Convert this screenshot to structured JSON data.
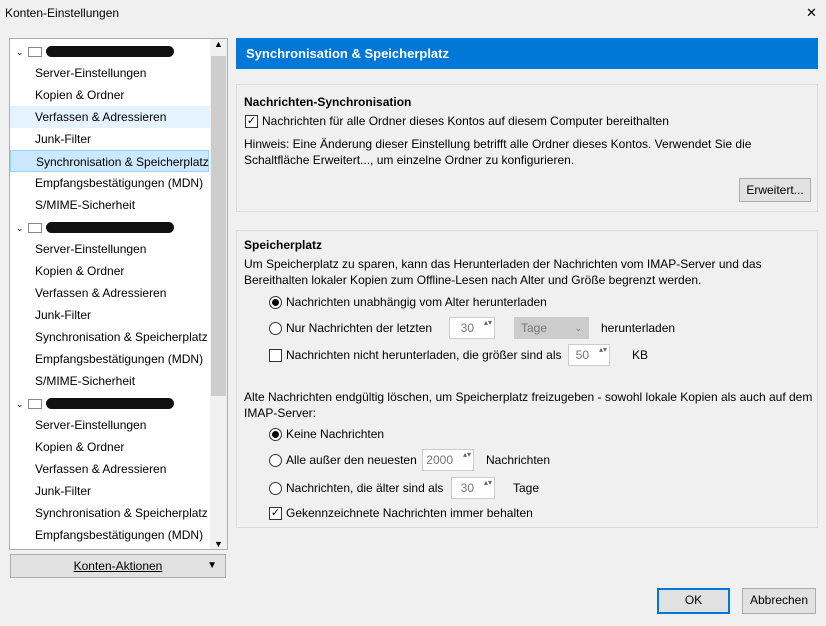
{
  "window": {
    "title": "Konten-Einstellungen",
    "close": "✕"
  },
  "tree": {
    "accounts": [
      {
        "items": [
          "Server-Einstellungen",
          "Kopien & Ordner",
          "Verfassen & Adressieren",
          "Junk-Filter",
          "Synchronisation & Speicherplatz",
          "Empfangsbestätigungen (MDN)",
          "S/MIME-Sicherheit"
        ]
      },
      {
        "items": [
          "Server-Einstellungen",
          "Kopien & Ordner",
          "Verfassen & Adressieren",
          "Junk-Filter",
          "Synchronisation & Speicherplatz",
          "Empfangsbestätigungen (MDN)",
          "S/MIME-Sicherheit"
        ]
      },
      {
        "items": [
          "Server-Einstellungen",
          "Kopien & Ordner",
          "Verfassen & Adressieren",
          "Junk-Filter",
          "Synchronisation & Speicherplatz",
          "Empfangsbestätigungen (MDN)"
        ]
      }
    ]
  },
  "account_actions": "Konten-Aktionen",
  "header": "Synchronisation & Speicherplatz",
  "sync": {
    "title": "Nachrichten-Synchronisation",
    "checkbox": "Nachrichten für alle Ordner dieses Kontos auf diesem Computer bereithalten",
    "hint": "Hinweis: Eine Änderung dieser Einstellung betrifft alle Ordner dieses Kontos. Verwendet Sie die Schaltfläche Erweitert..., um einzelne Ordner zu konfigurieren.",
    "advanced": "Erweitert..."
  },
  "storage": {
    "title": "Speicherplatz",
    "desc": "Um Speicherplatz zu sparen, kann das Herunterladen der Nachrichten vom IMAP-Server und das Bereithalten lokaler Kopien zum Offline-Lesen nach Alter und Größe begrenzt werden.",
    "opt1": "Nachrichten unabhängig vom Alter herunterladen",
    "opt2": "Nur Nachrichten der letzten",
    "opt2_value": "30",
    "opt2_unit": "Tage",
    "opt2_suffix": "herunterladen",
    "size_chk": "Nachrichten nicht herunterladen, die größer sind als",
    "size_value": "50",
    "size_unit": "KB",
    "delete_desc": "Alte Nachrichten endgültig löschen, um Speicherplatz freizugeben - sowohl lokale Kopien als auch auf dem IMAP-Server:",
    "d1": "Keine Nachrichten",
    "d2": "Alle außer den neuesten",
    "d2_value": "2000",
    "d2_suffix": "Nachrichten",
    "d3": "Nachrichten, die älter sind als",
    "d3_value": "30",
    "d3_suffix": "Tage",
    "keep": "Gekennzeichnete Nachrichten immer behalten"
  },
  "buttons": {
    "ok": "OK",
    "cancel": "Abbrechen"
  }
}
